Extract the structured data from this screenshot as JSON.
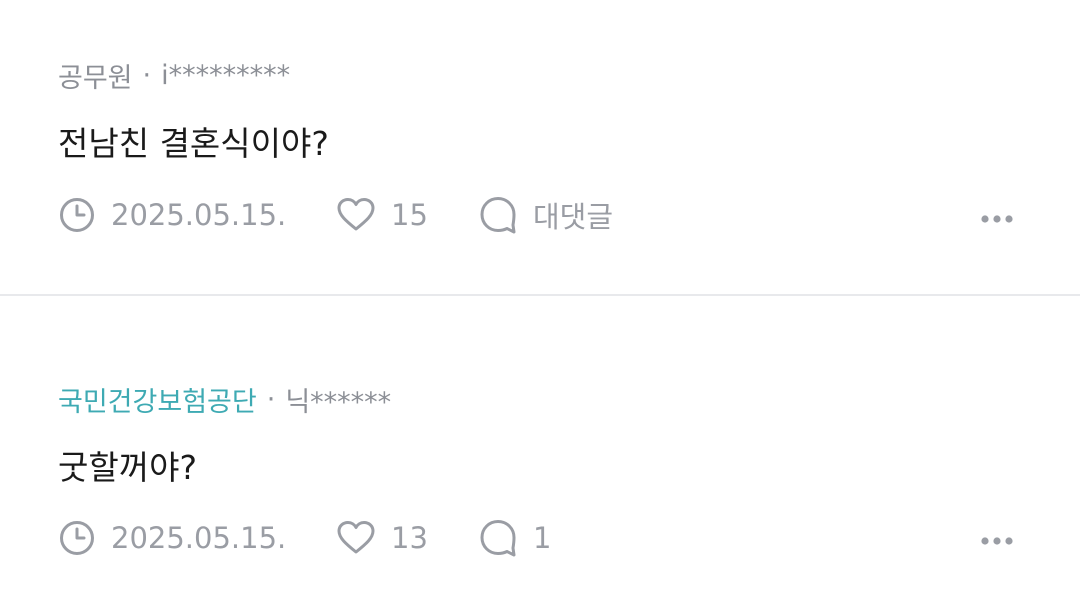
{
  "comments": [
    {
      "org": "공무원",
      "org_color": "#8c8f96",
      "separator": "·",
      "user": "i*********",
      "text": "전남친 결혼식이야?",
      "date": "2025.05.15.",
      "likes": "15",
      "reply_label": "대댓글",
      "icons": {
        "date": "clock-icon",
        "like": "heart-icon",
        "reply": "speech-bubble-icon",
        "more": "more-dots-icon"
      }
    },
    {
      "org": "국민건강보험공단",
      "org_color": "#3eaab3",
      "separator": "·",
      "user": "닉******",
      "text": "굿할꺼야?",
      "date": "2025.05.15.",
      "likes": "13",
      "reply_label": "1",
      "icons": {
        "date": "clock-icon",
        "like": "heart-icon",
        "reply": "speech-bubble-icon",
        "more": "more-dots-icon"
      }
    }
  ]
}
